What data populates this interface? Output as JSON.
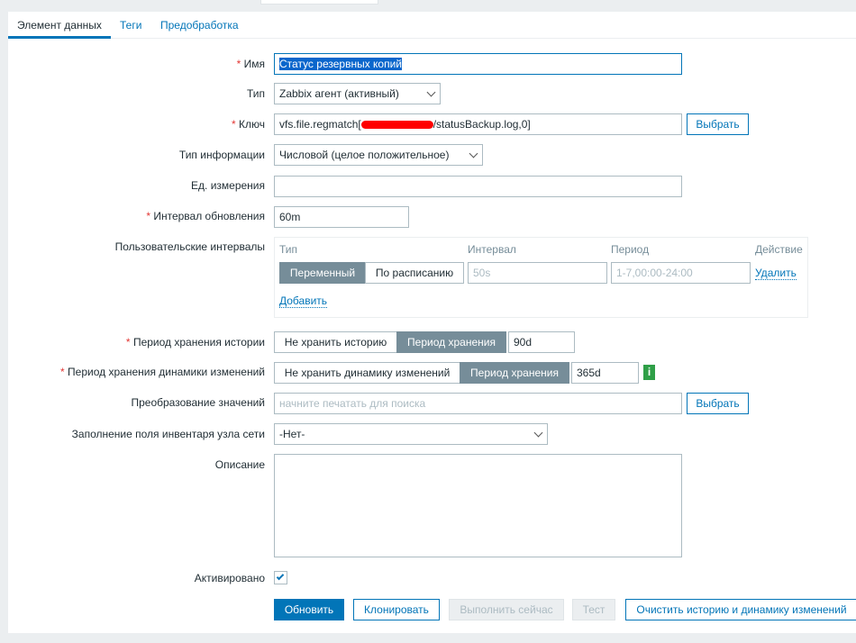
{
  "tabs": [
    "Элемент данных",
    "Теги",
    "Предобработка"
  ],
  "form": {
    "name": {
      "label": "Имя",
      "value": "Статус резервных копий"
    },
    "type": {
      "label": "Тип",
      "value": "Zabbix агент (активный)"
    },
    "key": {
      "label": "Ключ",
      "value_prefix": "vfs.file.regmatch[",
      "value_suffix": "/statusBackup.log,0]",
      "button": "Выбрать"
    },
    "info_type": {
      "label": "Тип информации",
      "value": "Числовой (целое положительное)"
    },
    "units": {
      "label": "Ед. измерения",
      "value": ""
    },
    "interval": {
      "label": "Интервал обновления",
      "value": "60m"
    },
    "custom": {
      "label": "Пользовательские интервалы",
      "headers": [
        "Тип",
        "Интервал",
        "Период",
        "Действие"
      ],
      "seg": [
        "Переменный",
        "По расписанию"
      ],
      "interval_ph": "50s",
      "period_ph": "1-7,00:00-24:00",
      "remove": "Удалить",
      "add": "Добавить"
    },
    "history": {
      "label": "Период хранения истории",
      "seg": [
        "Не хранить историю",
        "Период хранения"
      ],
      "value": "90d"
    },
    "trends": {
      "label": "Период хранения динамики изменений",
      "seg": [
        "Не хранить динамику изменений",
        "Период хранения"
      ],
      "value": "365d",
      "info": "i"
    },
    "valuemap": {
      "label": "Преобразование значений",
      "placeholder": "начните печатать для поиска",
      "button": "Выбрать"
    },
    "inventory": {
      "label": "Заполнение поля инвентаря узла сети",
      "value": "-Нет-"
    },
    "description": {
      "label": "Описание",
      "value": ""
    },
    "enabled": {
      "label": "Активировано",
      "checked": true
    }
  },
  "buttons": [
    "Обновить",
    "Клонировать",
    "Выполнить сейчас",
    "Тест",
    "Очистить историю и динамику изменений"
  ],
  "colors": {
    "accent": "#0275b8",
    "required": "#e33734",
    "info": "#2f9f47"
  }
}
